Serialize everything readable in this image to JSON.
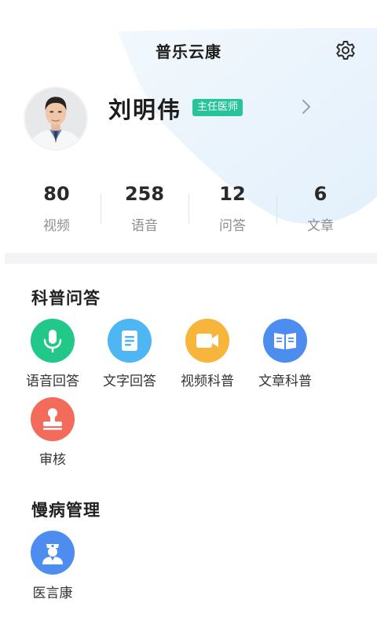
{
  "header": {
    "app_title": "普乐云康"
  },
  "profile": {
    "name": "刘明伟",
    "title_badge": "主任医师"
  },
  "stats": [
    {
      "value": "80",
      "label": "视频"
    },
    {
      "value": "258",
      "label": "语音"
    },
    {
      "value": "12",
      "label": "问答"
    },
    {
      "value": "6",
      "label": "文章"
    }
  ],
  "sections": {
    "science_qa": {
      "title": "科普问答",
      "tools": [
        {
          "label": "语音回答",
          "icon": "microphone-icon",
          "color": "#22c78a"
        },
        {
          "label": "文字回答",
          "icon": "document-icon",
          "color": "#4fb6f4"
        },
        {
          "label": "视频科普",
          "icon": "video-camera-icon",
          "color": "#f7b53b"
        },
        {
          "label": "文章科普",
          "icon": "open-book-icon",
          "color": "#4d8df0"
        },
        {
          "label": "审核",
          "icon": "stamp-icon",
          "color": "#f26b5b"
        }
      ]
    },
    "chronic_mgmt": {
      "title": "慢病管理",
      "tools": [
        {
          "label": "医言康",
          "icon": "nurse-icon",
          "color": "#4d8df0"
        }
      ]
    }
  }
}
